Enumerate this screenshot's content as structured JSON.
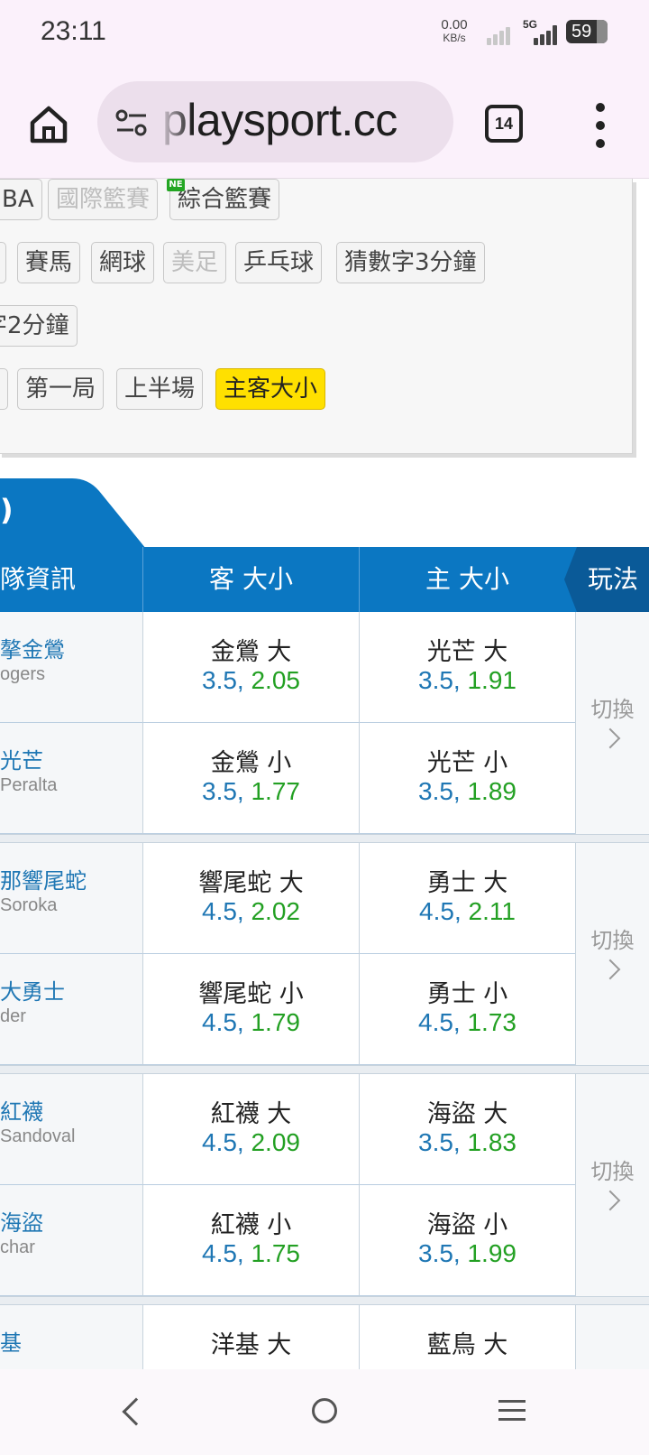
{
  "status": {
    "time": "23:11",
    "net_speed_value": "0.00",
    "net_speed_unit": "KB/s",
    "network": "5G",
    "battery": "59"
  },
  "browser": {
    "url": "playsport.cc",
    "tab_count": "14"
  },
  "filters": {
    "row1": [
      "BA",
      "國際籃賽",
      "綜合籃賽"
    ],
    "row1_disabled": [
      false,
      true,
      false
    ],
    "new_badge": "NEW",
    "row2": [
      "賽馬",
      "網球",
      "美足",
      "乒乓球",
      "猜數字3分鐘"
    ],
    "row2_disabled": [
      false,
      false,
      true,
      false,
      false
    ],
    "row3": [
      "字2分鐘"
    ],
    "row4": [
      "第一局",
      "上半場",
      "主客大小"
    ],
    "active": "主客大小"
  },
  "section": {
    "tab_label": ")"
  },
  "table": {
    "headers": {
      "team": "隊資訊",
      "away": "客 大小",
      "home": "主 大小",
      "play": "玩法"
    },
    "switch_label": "切換",
    "games": [
      {
        "rows": [
          {
            "team": "摮金鶯",
            "pitcher": "ogers",
            "away_label": "金鶯 大",
            "away_line": "3.5,",
            "away_price": "2.05",
            "home_label": "光芒 大",
            "home_line": "3.5,",
            "home_price": "1.91"
          },
          {
            "team": "光芒",
            "pitcher": "Peralta",
            "away_label": "金鶯 小",
            "away_line": "3.5,",
            "away_price": "1.77",
            "home_label": "光芒 小",
            "home_line": "3.5,",
            "home_price": "1.89"
          }
        ]
      },
      {
        "rows": [
          {
            "team": "那響尾蛇",
            "pitcher": "Soroka",
            "away_label": "響尾蛇 大",
            "away_line": "4.5,",
            "away_price": "2.02",
            "home_label": "勇士 大",
            "home_line": "4.5,",
            "home_price": "2.11"
          },
          {
            "team": "大勇士",
            "pitcher": "der",
            "away_label": "響尾蛇 小",
            "away_line": "4.5,",
            "away_price": "1.79",
            "home_label": "勇士 小",
            "home_line": "4.5,",
            "home_price": "1.73"
          }
        ]
      },
      {
        "rows": [
          {
            "team": "紅襪",
            "pitcher": "Sandoval",
            "away_label": "紅襪 大",
            "away_line": "4.5,",
            "away_price": "2.09",
            "home_label": "海盜 大",
            "home_line": "3.5,",
            "home_price": "1.83"
          },
          {
            "team": "海盜",
            "pitcher": "char",
            "away_label": "紅襪 小",
            "away_line": "4.5,",
            "away_price": "1.75",
            "home_label": "海盜 小",
            "home_line": "3.5,",
            "home_price": "1.99"
          }
        ]
      },
      {
        "rows": [
          {
            "team": "基",
            "pitcher": "",
            "away_label": "洋基 大",
            "away_line": "",
            "away_price": "",
            "home_label": "藍鳥 大",
            "home_line": "",
            "home_price": ""
          }
        ]
      }
    ]
  },
  "colors": {
    "header_blue": "#0b77c2",
    "play_header": "#0a5a98",
    "active_chip": "#ffe000",
    "odds_line": "#1f77b4",
    "odds_price": "#23a023"
  }
}
